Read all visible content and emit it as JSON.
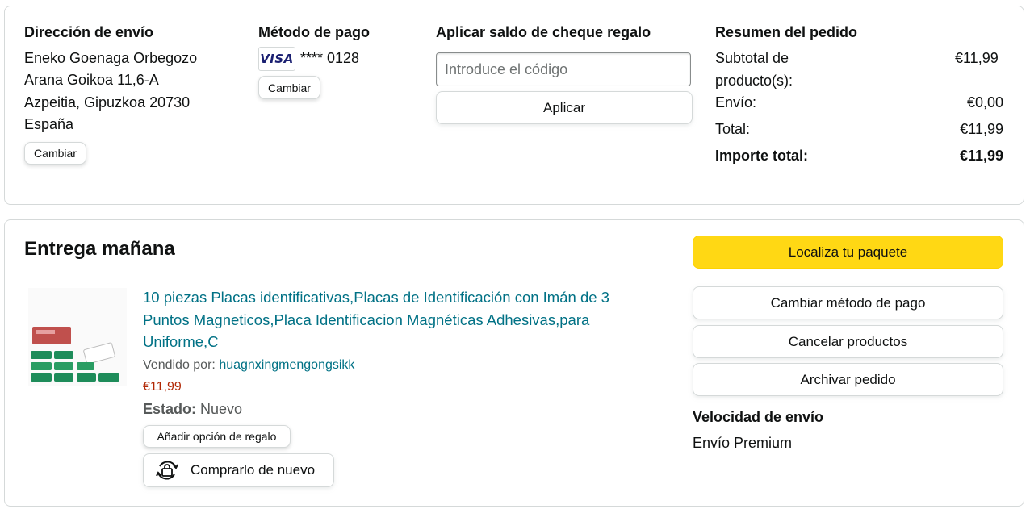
{
  "shipping": {
    "heading": "Dirección de envío",
    "name": "Eneko Goenaga Orbegozo",
    "street": "Arana Goikoa 11,6-A",
    "city": "Azpeitia, Gipuzkoa 20730",
    "country": "España",
    "change_label": "Cambiar"
  },
  "payment": {
    "heading": "Método de pago",
    "card_brand": "VISA",
    "card_number": "**** 0128",
    "change_label": "Cambiar"
  },
  "gift": {
    "heading": "Aplicar saldo de cheque regalo",
    "input_placeholder": "Introduce el código",
    "apply_label": "Aplicar"
  },
  "summary": {
    "heading": "Resumen del pedido",
    "subtotal_label_1": "Subtotal de",
    "subtotal_label_2": "producto(s):",
    "subtotal_value": "€11,99",
    "shipping_label": "Envío:",
    "shipping_value": "€0,00",
    "total_label": "Total:",
    "total_value": "€11,99",
    "grand_label": "Importe total:",
    "grand_value": "€11,99"
  },
  "delivery": {
    "heading": "Entrega mañana",
    "product": {
      "title_line1": "10 piezas Placas identificativas,Placas de Identificación con Imán de 3",
      "title_line2": "Puntos Magneticos,Placa Identificacion Magnéticas Adhesivas,para",
      "title_line3": "Uniforme,C",
      "sold_by_label": "Vendido por:",
      "seller": "huagnxingmengongsikk",
      "price": "€11,99",
      "condition_label": "Estado:",
      "condition": "Nuevo",
      "gift_option_label": "Añadir opción de regalo",
      "buy_again_label": "Comprarlo de nuevo"
    },
    "actions": {
      "track": "Localiza tu paquete",
      "change_payment": "Cambiar método de pago",
      "cancel": "Cancelar productos",
      "archive": "Archivar pedido"
    },
    "speed_heading": "Velocidad de envío",
    "speed_value": "Envío Premium"
  },
  "colors": {
    "primary_button": "#ffd814",
    "link": "#007185",
    "price": "#b12704"
  }
}
